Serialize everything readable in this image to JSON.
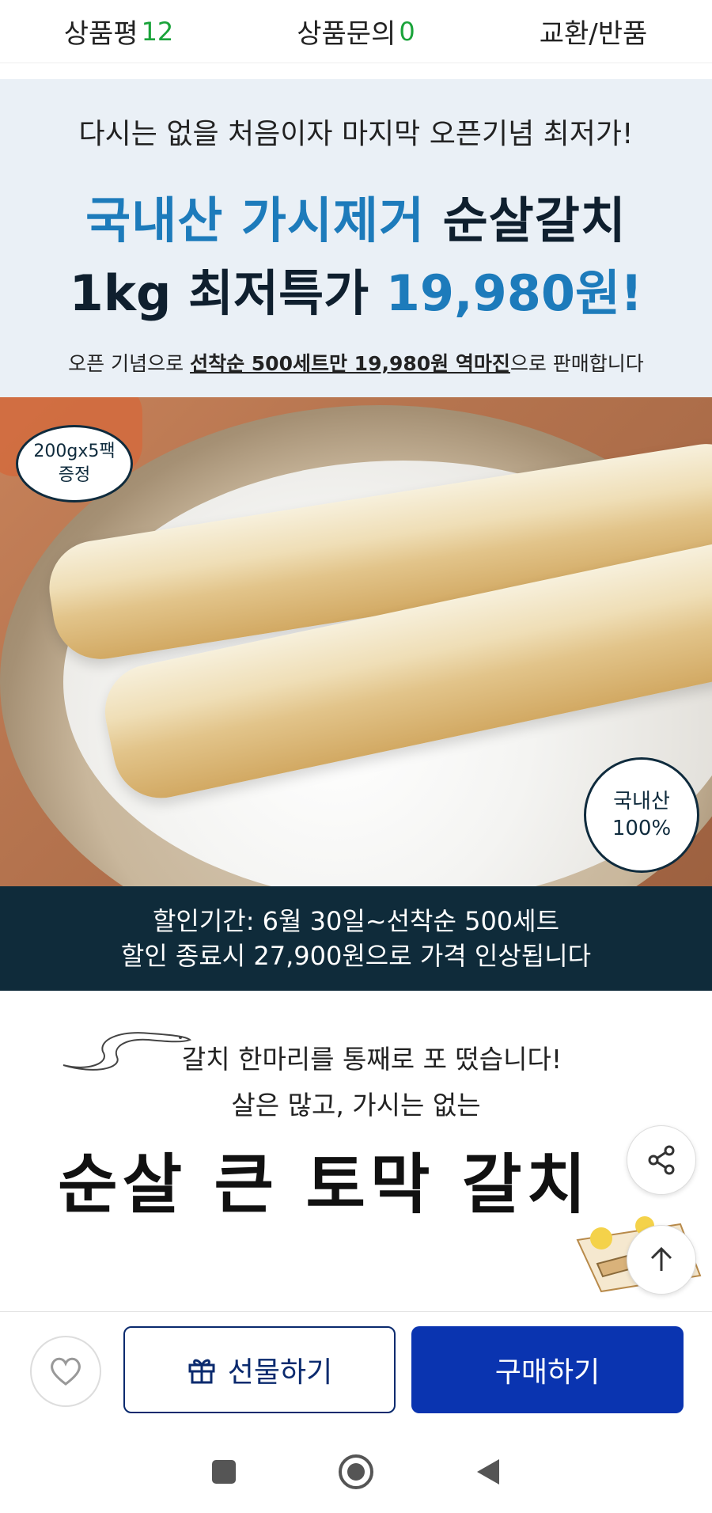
{
  "tabs": [
    {
      "label": "상품평",
      "count": "12"
    },
    {
      "label": "상품문의",
      "count": "0"
    },
    {
      "label": "교환/반품",
      "count": ""
    }
  ],
  "promo": {
    "subtitle": "다시는 없을 처음이자 마지막 오픈기념 최저가!",
    "title_blue": "국내산 가시제거",
    "title_dark": "순살갈치",
    "title2_prefix": "1kg 최저특가",
    "title2_price": "19,980원",
    "title2_suffix": "!",
    "note_prefix": "오픈 기념으로",
    "note_highlight": "선착순 500세트만 19,980원 역마진",
    "note_suffix": "으로 판매합니다"
  },
  "badges": {
    "gift_line1": "200gx5팩",
    "gift_line2": "증정",
    "domestic_line1": "국내산",
    "domestic_line2": "100%"
  },
  "discount": {
    "line1": "할인기간: 6월 30일~선착순 500세트",
    "line2": "할인 종료시 27,900원으로 가격 인상됩니다"
  },
  "intro": {
    "line1": "갈치 한마리를 통째로 포 떴습니다!",
    "line2": "살은 많고, 가시는 없는",
    "title": "순살 큰 토막 갈치"
  },
  "actions": {
    "gift_label": "선물하기",
    "buy_label": "구매하기"
  },
  "colors": {
    "accent_blue": "#1d7bbb",
    "navy": "#0f2b3a",
    "buy_blue": "#0a34b0",
    "count_green": "#1aa33a"
  },
  "icons": [
    "heart-icon",
    "gift-icon",
    "share-icon",
    "arrow-up-icon",
    "nav-recents-icon",
    "nav-home-icon",
    "nav-back-icon"
  ]
}
